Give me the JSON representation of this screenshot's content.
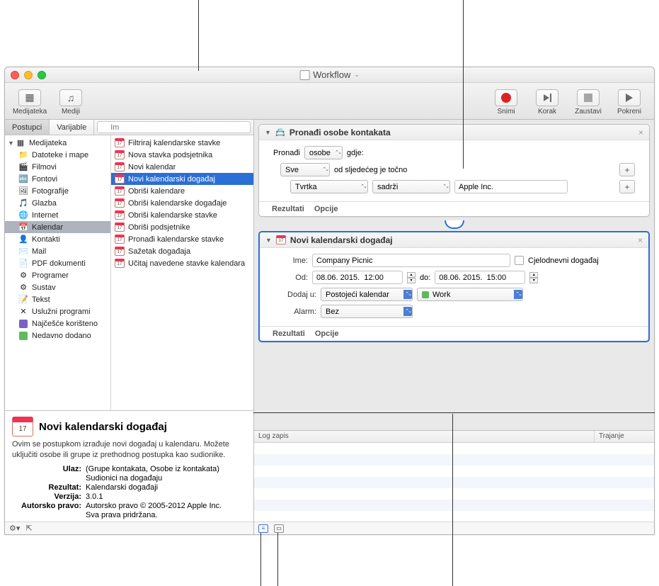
{
  "window": {
    "title": "Workflow"
  },
  "toolbar": {
    "medijateka": "Medijateka",
    "mediji": "Mediji",
    "snimi": "Snimi",
    "korak": "Korak",
    "zaustavi": "Zaustavi",
    "pokreni": "Pokreni"
  },
  "tabs": {
    "postupci": "Postupci",
    "varijable": "Varijable",
    "search_placeholder": "Im"
  },
  "library": {
    "root": "Medijateka",
    "categories": [
      "Datoteke i mape",
      "Filmovi",
      "Fontovi",
      "Fotografije",
      "Glazba",
      "Internet",
      "Kalendar",
      "Kontakti",
      "Mail",
      "PDF dokumenti",
      "Programer",
      "Sustav",
      "Tekst",
      "Uslužni programi"
    ],
    "smart": [
      "Najčešće korišteno",
      "Nedavno dodano"
    ],
    "selected_category": "Kalendar",
    "actions": [
      "Filtriraj kalendarske stavke",
      "Nova stavka podsjetnika",
      "Novi kalendar",
      "Novi kalendarski događaj",
      "Obriši kalendare",
      "Obriši kalendarske događaje",
      "Obriši kalendarske stavke",
      "Obriši podsjetnike",
      "Pronađi kalendarske stavke",
      "Sažetak događaja",
      "Učitaj navedene stavke kalendara"
    ],
    "selected_action": "Novi kalendarski događaj"
  },
  "info": {
    "title": "Novi kalendarski događaj",
    "desc": "Ovim se postupkom izrađuje novi događaj u kalendaru. Možete uključiti osobe ili grupe iz prethodnog postupka kao sudionike.",
    "labels": {
      "ulaz": "Ulaz:",
      "rezultat": "Rezultat:",
      "verzija": "Verzija:",
      "autorsko": "Autorsko pravo:"
    },
    "ulaz_v1": "(Grupe kontakata, Osobe iz kontakata)",
    "ulaz_v2": "Sudionici na događaju",
    "rezultat_v": "Kalendarski događaji",
    "verzija_v": "3.0.1",
    "autorsko_v1": "Autorsko pravo © 2005-2012 Apple Inc.",
    "autorsko_v2": "Sva prava pridržana."
  },
  "action1": {
    "title": "Pronađi osobe kontakata",
    "find_label": "Pronađi",
    "find_sel": "osobe",
    "where_label": "gdje:",
    "cond_sel": "Sve",
    "cond_text": "od sljedećeg je točno",
    "field_sel": "Tvrtka",
    "op_sel": "sadrži",
    "value": "Apple Inc.",
    "rezultati": "Rezultati",
    "opcije": "Opcije"
  },
  "action2": {
    "title": "Novi kalendarski događaj",
    "ime_label": "Ime:",
    "ime_value": "Company Picnic",
    "allday_label": "Cjelodnevni događaj",
    "od_label": "Od:",
    "od_value": "08.06. 2015.  12:00",
    "do_label": "do:",
    "do_value": "08.06. 2015.  15:00",
    "dodaj_label": "Dodaj u:",
    "dodaj_sel": "Postojeći kalendar",
    "cal_sel": "Work",
    "alarm_label": "Alarm:",
    "alarm_sel": "Bez",
    "rezultati": "Rezultati",
    "opcije": "Opcije"
  },
  "log": {
    "col1": "Log zapis",
    "col2": "Trajanje"
  }
}
